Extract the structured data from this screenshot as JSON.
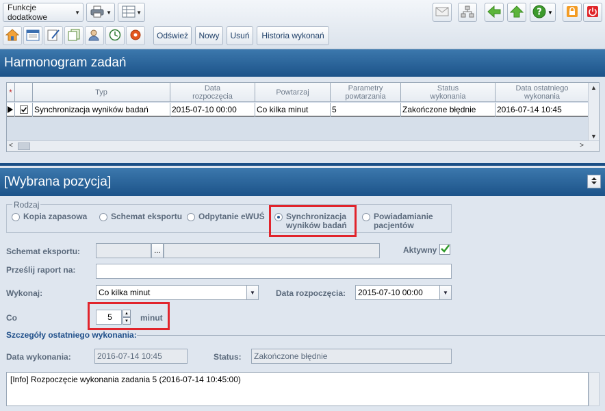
{
  "toolbar": {
    "functions_label": "Funkcje dodatkowe",
    "buttons": {
      "refresh": "Odśwież",
      "new": "Nowy",
      "delete": "Usuń",
      "history": "Historia wykonań"
    }
  },
  "grid_section": {
    "title": "Harmonogram zadań"
  },
  "grid": {
    "columns": [
      {
        "key": "type",
        "label": "Typ"
      },
      {
        "key": "start",
        "label": "Data\nrozpoczęcia"
      },
      {
        "key": "repeat",
        "label": "Powtarzaj"
      },
      {
        "key": "param",
        "label": "Parametry\npowtarzania"
      },
      {
        "key": "status",
        "label": "Status\nwykonania"
      },
      {
        "key": "last",
        "label": "Data ostatniego\nwykonania"
      }
    ],
    "rows": [
      {
        "type": "Synchronizacja wyników badań",
        "start": "2015-07-10 00:00",
        "repeat": "Co kilka minut",
        "param": "5",
        "status": "Zakończone błędnie",
        "last": "2016-07-14 10:45"
      }
    ]
  },
  "detail_section": {
    "title": "[Wybrana pozycja]"
  },
  "detail": {
    "kind_group_label": "Rodzaj",
    "kinds": [
      {
        "label": "Kopia zapasowa",
        "selected": false
      },
      {
        "label": "Schemat eksportu",
        "selected": false
      },
      {
        "label": "Odpytanie eWUŚ",
        "selected": false
      },
      {
        "label": "Synchronizacja\nwyników badań",
        "selected": true
      },
      {
        "label": "Powiadamianie\npacjentów",
        "selected": false
      }
    ],
    "export_schema_label": "Schemat eksportu:",
    "export_schema_value": "",
    "active_label": "Aktywny",
    "active_checked": true,
    "send_report_label": "Prześlij raport na:",
    "send_report_value": "",
    "execute_label": "Wykonaj:",
    "execute_value": "Co kilka minut",
    "start_date_label": "Data rozpoczęcia:",
    "start_date_value": "2015-07-10 00:00",
    "every_label": "Co",
    "every_value": "5",
    "every_unit": "minut",
    "last_run_group": "Szczegóły ostatniego wykonania:",
    "exec_date_label": "Data wykonania:",
    "exec_date_value": "2016-07-14 10:45",
    "status_label": "Status:",
    "status_value": "Zakończone błędnie",
    "log_text": "[Info] Rozpoczęcie wykonania zadania 5 (2016-07-14 10:45:00)"
  }
}
